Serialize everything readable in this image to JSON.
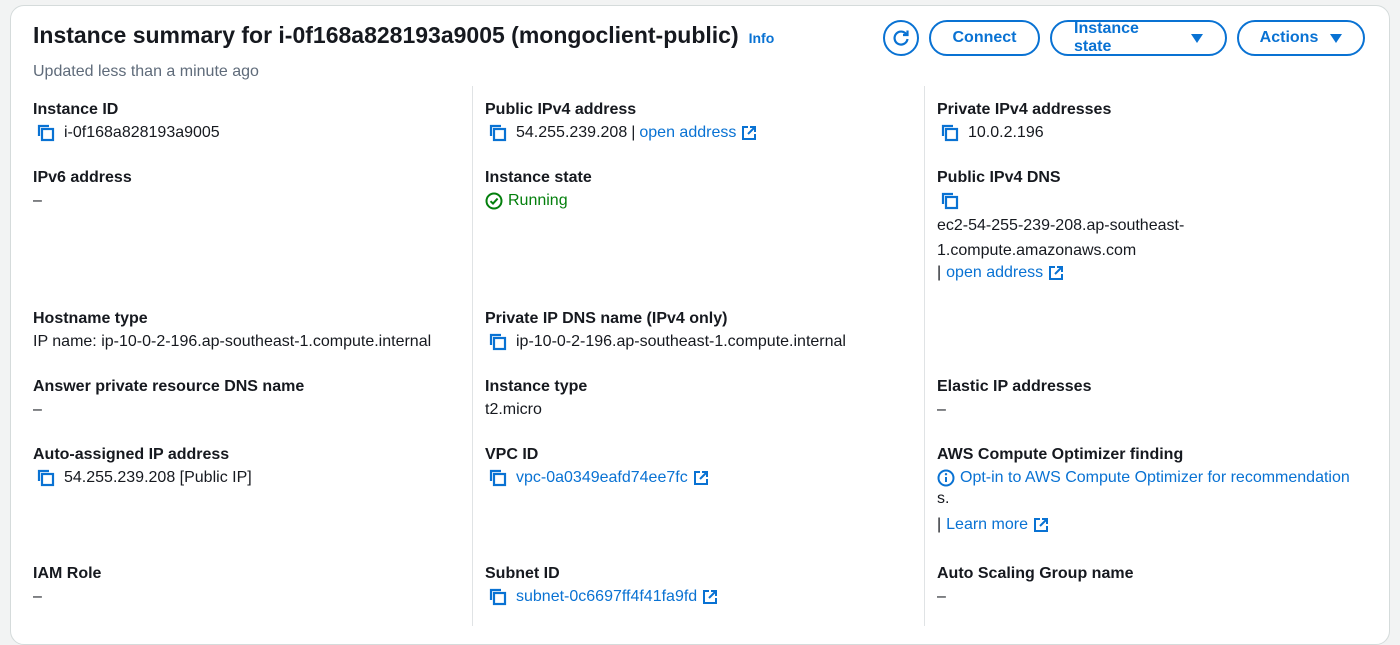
{
  "header": {
    "title": "Instance summary for i-0f168a828193a9005 (mongoclient-public)",
    "info": "Info",
    "subtitle": "Updated less than a minute ago"
  },
  "toolbar": {
    "connect": "Connect",
    "instance_state": "Instance state",
    "actions": "Actions"
  },
  "fields": {
    "instance_id": {
      "label": "Instance ID",
      "value": "i-0f168a828193a9005"
    },
    "public_ipv4": {
      "label": "Public IPv4 address",
      "value": "54.255.239.208",
      "separator": "|",
      "link": "open address"
    },
    "private_ipv4": {
      "label": "Private IPv4 addresses",
      "value": "10.0.2.196"
    },
    "ipv6": {
      "label": "IPv6 address",
      "value": "–"
    },
    "instance_state": {
      "label": "Instance state",
      "value": "Running"
    },
    "public_dns": {
      "label": "Public IPv4 DNS",
      "line1": "ec2-54-255-239-208.ap-southeast-",
      "line2": "1.compute.amazonaws.com",
      "separator": "|",
      "link": "open address"
    },
    "hostname_type": {
      "label": "Hostname type",
      "value": "IP name: ip-10-0-2-196.ap-southeast-1.compute.internal"
    },
    "private_dns": {
      "label": "Private IP DNS name (IPv4 only)",
      "value": "ip-10-0-2-196.ap-southeast-1.compute.internal"
    },
    "answer_dns": {
      "label": "Answer private resource DNS name",
      "value": "–"
    },
    "instance_type": {
      "label": "Instance type",
      "value": "t2.micro"
    },
    "elastic_ip": {
      "label": "Elastic IP addresses",
      "value": "–"
    },
    "auto_ip": {
      "label": "Auto-assigned IP address",
      "value": "54.255.239.208 [Public IP]"
    },
    "vpc_id": {
      "label": "VPC ID",
      "value": "vpc-0a0349eafd74ee7fc"
    },
    "optimizer": {
      "label": "AWS Compute Optimizer finding",
      "line1": "Opt-in to AWS Compute Optimizer for recommendation",
      "line2": "s.",
      "separator": "|",
      "link": "Learn more"
    },
    "iam_role": {
      "label": "IAM Role",
      "value": "–"
    },
    "subnet_id": {
      "label": "Subnet ID",
      "value": "subnet-0c6697ff4f41fa9fd"
    },
    "asg_name": {
      "label": "Auto Scaling Group name",
      "value": "–"
    }
  },
  "colors": {
    "link": "#0972d3",
    "success": "#037f0c",
    "text": "#16191f",
    "muted": "#5f6b7a"
  }
}
